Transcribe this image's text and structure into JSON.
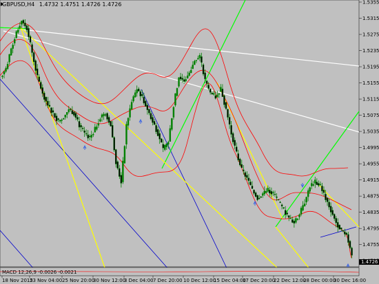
{
  "window": {
    "symbol": "GBPUSD,H4",
    "ohlc": "1.4732 1.4751 1.4726 1.4726",
    "indicator_label": "MACD 12,26,9 -0.0026 -0.0021"
  },
  "colors": {
    "background": "#c0c0c0",
    "candle": "#008000",
    "bollinger": "#ff0000",
    "yellow_lines": "#ffff00",
    "green_lines": "#00ff00",
    "white_lines": "#ffffff",
    "blue_lines": "#0000cd",
    "fractal_arrows": "#4169e1"
  },
  "price_axis": {
    "min": 1.47,
    "max": 1.5355,
    "ticks": [
      "1.5355",
      "1.5315",
      "1.5275",
      "1.5235",
      "1.5195",
      "1.5155",
      "1.5115",
      "1.5075",
      "1.5035",
      "1.4995",
      "1.4955",
      "1.4915",
      "1.4875",
      "1.4835",
      "1.4795",
      "1.4755",
      "1.4715"
    ],
    "current_price": "1.4726"
  },
  "time_axis": {
    "labels": [
      "18 Nov 2015",
      "23 Nov 04:00",
      "25 Nov 20:00",
      "30 Nov 12:00",
      "3 Dec 04:00",
      "7 Dec 20:00",
      "10 Dec 12:00",
      "15 Dec 04:00",
      "17 Dec 20:00",
      "22 Dec 12:00",
      "28 Dec 00:00",
      "30 Dec 16:00"
    ]
  },
  "chart_data": {
    "type": "candlestick",
    "series_close_approx": [
      1.519,
      1.524,
      1.528,
      1.531,
      1.529,
      1.523,
      1.517,
      1.513,
      1.51,
      1.508,
      1.506,
      1.507,
      1.509,
      1.508,
      1.505,
      1.503,
      1.502,
      1.504,
      1.507,
      1.508,
      1.505,
      1.496,
      1.491,
      1.505,
      1.511,
      1.514,
      1.512,
      1.509,
      1.506,
      1.503,
      1.499,
      1.501,
      1.51,
      1.517,
      1.516,
      1.518,
      1.521,
      1.522,
      1.516,
      1.513,
      1.512,
      1.514,
      1.509,
      1.503,
      1.498,
      1.494,
      1.492,
      1.489,
      1.487,
      1.488,
      1.489,
      1.488,
      1.486,
      1.484,
      1.482,
      1.481,
      1.483,
      1.486,
      1.49,
      1.491,
      1.49,
      1.487,
      1.484,
      1.481,
      1.479,
      1.478,
      1.473
    ],
    "ylim": [
      1.47,
      1.5355
    ]
  }
}
